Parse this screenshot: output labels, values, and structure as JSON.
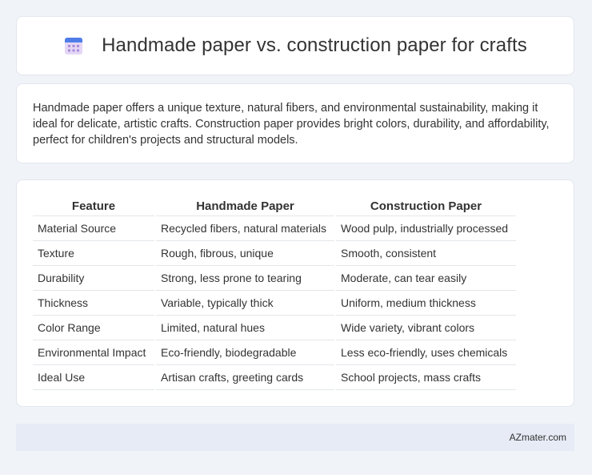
{
  "header": {
    "title": "Handmade paper vs. construction paper for crafts",
    "icon": "calendar-icon"
  },
  "intro": {
    "text": "Handmade paper offers a unique texture, natural fibers, and environmental sustainability, making it ideal for delicate, artistic crafts. Construction paper provides bright colors, durability, and affordability, perfect for children's projects and structural models."
  },
  "table": {
    "headers": [
      "Feature",
      "Handmade Paper",
      "Construction Paper"
    ],
    "rows": [
      [
        "Material Source",
        "Recycled fibers, natural materials",
        "Wood pulp, industrially processed"
      ],
      [
        "Texture",
        "Rough, fibrous, unique",
        "Smooth, consistent"
      ],
      [
        "Durability",
        "Strong, less prone to tearing",
        "Moderate, can tear easily"
      ],
      [
        "Thickness",
        "Variable, typically thick",
        "Uniform, medium thickness"
      ],
      [
        "Color Range",
        "Limited, natural hues",
        "Wide variety, vibrant colors"
      ],
      [
        "Environmental Impact",
        "Eco-friendly, biodegradable",
        "Less eco-friendly, uses chemicals"
      ],
      [
        "Ideal Use",
        "Artisan crafts, greeting cards",
        "School projects, mass crafts"
      ]
    ]
  },
  "footer": {
    "brand": "AZmater.com"
  },
  "colors": {
    "background": "#f0f3f8",
    "footer": "#e6ebf5",
    "icon_top": "#4f7de8",
    "icon_body": "#d9c4f0"
  }
}
